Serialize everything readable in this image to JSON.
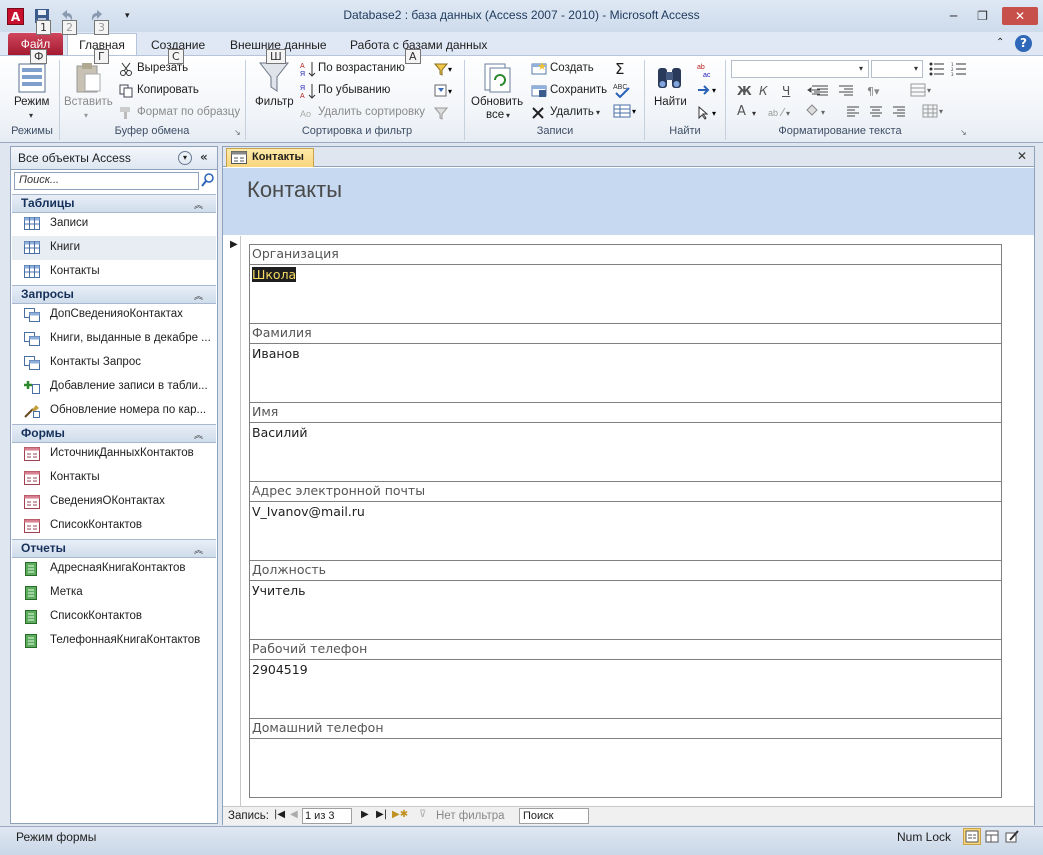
{
  "app": {
    "window_title": "Database2 : база данных (Access 2007 - 2010)  -  Microsoft Access",
    "icon_letter": "A",
    "qat_keytips": [
      "1",
      "2",
      "3"
    ]
  },
  "tabs": {
    "file": "Файл",
    "items": [
      "Главная",
      "Создание",
      "Внешние данные",
      "Работа с базами данных"
    ],
    "keytips": {
      "file": "Ф",
      "home": "Г",
      "create": "С",
      "external": "Ш",
      "database": "А"
    }
  },
  "ribbon": {
    "views": {
      "mode": "Режим",
      "group": "Режимы"
    },
    "clipboard": {
      "paste": "Вставить",
      "cut": "Вырезать",
      "copy": "Копировать",
      "format_painter": "Формат по образцу",
      "group": "Буфер обмена"
    },
    "sort_filter": {
      "filter": "Фильтр",
      "ascending": "По возрастанию",
      "descending": "По убыванию",
      "remove_sort": "Удалить сортировку",
      "group": "Сортировка и фильтр"
    },
    "records": {
      "refresh_line1": "Обновить",
      "refresh_line2": "все",
      "create": "Создать",
      "save": "Сохранить",
      "delete": "Удалить",
      "group": "Записи"
    },
    "find": {
      "find": "Найти",
      "group": "Найти"
    },
    "text_format": {
      "bold": "Ж",
      "italic": "К",
      "underline": "Ч",
      "font_color_letter": "A",
      "group": "Форматирование текста"
    }
  },
  "nav": {
    "title": "Все объекты Access",
    "search_placeholder": "Поиск...",
    "groups": [
      {
        "label": "Таблицы",
        "items": [
          "Записи",
          "Книги",
          "Контакты"
        ]
      },
      {
        "label": "Запросы",
        "items": [
          "ДопСведенияоКонтактах",
          "Книги, выданные в декабре ...",
          "Контакты Запрос",
          "Добавление записи в табли...",
          "Обновление номера по кар..."
        ]
      },
      {
        "label": "Формы",
        "items": [
          "ИсточникДанныхКонтактов",
          "Контакты",
          "СведенияОКонтактах",
          "СписокКонтактов"
        ]
      },
      {
        "label": "Отчеты",
        "items": [
          "АдреснаяКнигаКонтактов",
          "Метка",
          "СписокКонтактов",
          "ТелефоннаяКнигаКонтактов"
        ]
      }
    ]
  },
  "document": {
    "tab_label": "Контакты",
    "form_title": "Контакты",
    "fields": [
      {
        "label": "Организация",
        "value": "Школа"
      },
      {
        "label": "Фамилия",
        "value": "Иванов"
      },
      {
        "label": "Имя",
        "value": "Василий"
      },
      {
        "label": "Адрес электронной почты",
        "value": "V_Ivanov@mail.ru"
      },
      {
        "label": "Должность",
        "value": "Учитель"
      },
      {
        "label": "Рабочий телефон",
        "value": "2904519"
      },
      {
        "label": "Домашний телефон",
        "value": ""
      }
    ]
  },
  "record_nav": {
    "label": "Запись:",
    "position": "1 из 3",
    "filter": "Нет фильтра",
    "search": "Поиск"
  },
  "status": {
    "mode": "Режим формы",
    "numlock": "Num Lock"
  },
  "colors": {
    "file_tab": "#b5243a",
    "form_header": "#c6d9f1",
    "doc_tab": "#f9d57c",
    "selection_text": "#f5dc64"
  }
}
